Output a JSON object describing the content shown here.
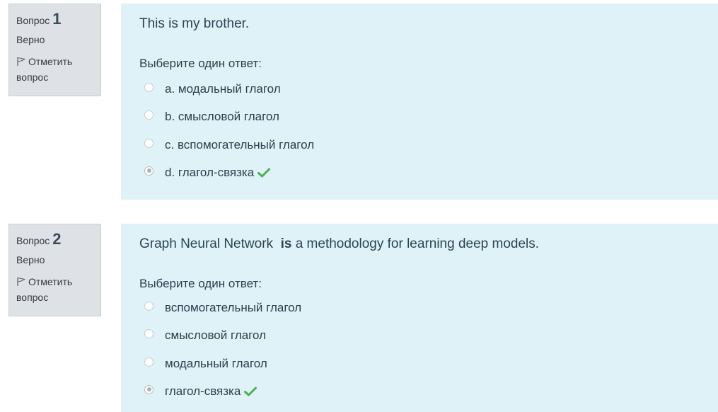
{
  "questions": [
    {
      "label": "Вопрос",
      "number": "1",
      "state": "Верно",
      "flag_label": "Отметить вопрос",
      "text_before": "This is my brother.",
      "text_bold": "",
      "text_after": "",
      "prompt": "Выберите один ответ:",
      "answers": [
        {
          "text": "a. модальный глагол",
          "selected": false,
          "correct": false
        },
        {
          "text": "b. смысловой глагол",
          "selected": false,
          "correct": false
        },
        {
          "text": "c. вспомогательный глагол",
          "selected": false,
          "correct": false
        },
        {
          "text": "d. глагол-связка",
          "selected": true,
          "correct": true
        }
      ]
    },
    {
      "label": "Вопрос",
      "number": "2",
      "state": "Верно",
      "flag_label": "Отметить вопрос",
      "text_before": "Graph Neural Network  ",
      "text_bold": "is",
      "text_after": " a methodology for learning deep models.",
      "prompt": "Выберите один ответ:",
      "answers": [
        {
          "text": "вспомогательный глагол",
          "selected": false,
          "correct": false
        },
        {
          "text": "смысловой глагол",
          "selected": false,
          "correct": false
        },
        {
          "text": "модальный глагол",
          "selected": false,
          "correct": false
        },
        {
          "text": "глагол-связка",
          "selected": true,
          "correct": true
        }
      ]
    }
  ],
  "colors": {
    "info_bg": "#dee2e6",
    "content_bg": "#def2f8",
    "correct_check": "#4caf50"
  }
}
